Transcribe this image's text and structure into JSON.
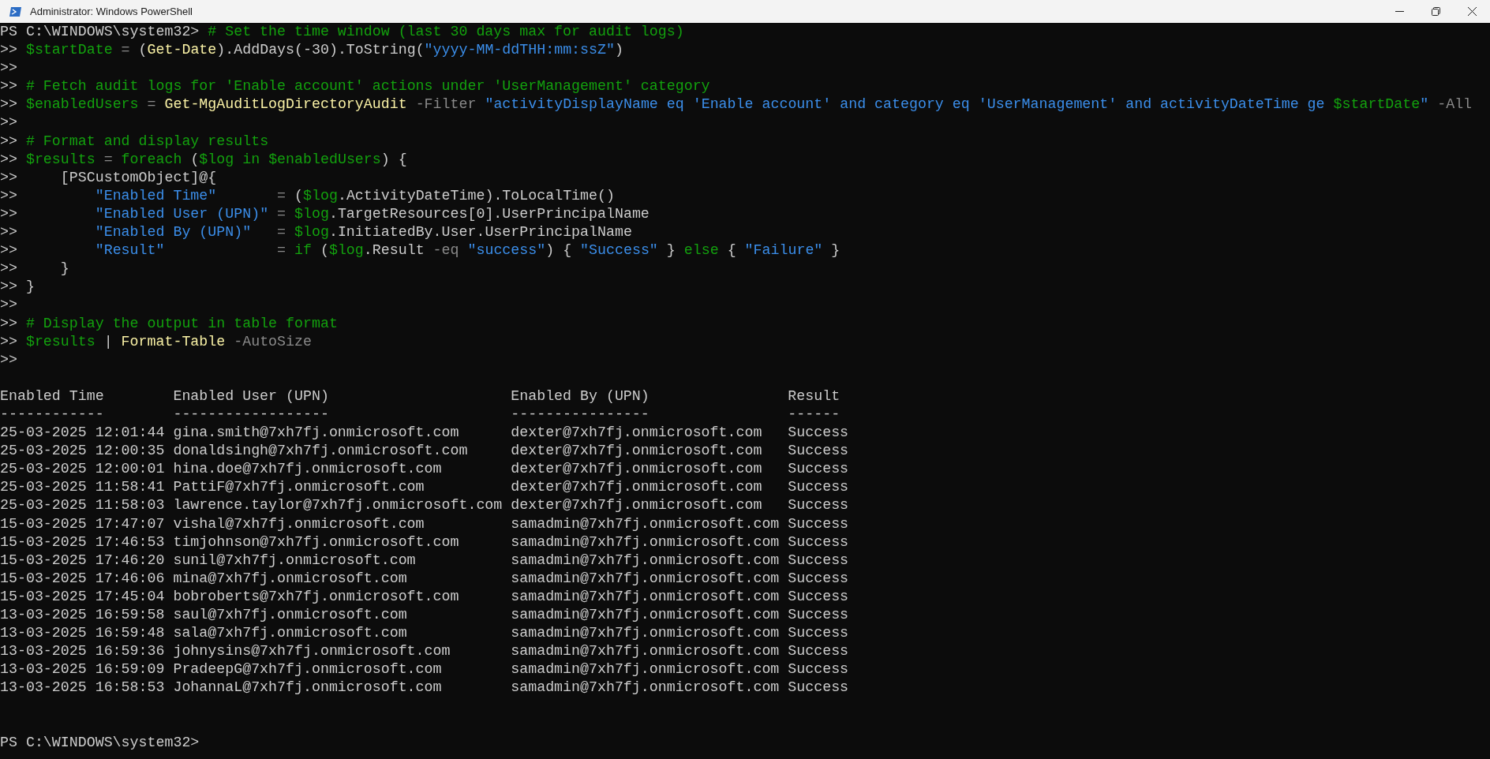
{
  "window": {
    "title": "Administrator: Windows PowerShell"
  },
  "console": {
    "lines": [
      [
        {
          "kind": "prompt",
          "text": "PS C:\\WINDOWS\\system32> "
        },
        {
          "kind": "comment",
          "text": "# Set the time window (last 30 days max for audit logs)"
        }
      ],
      [
        {
          "kind": "prompt",
          "text": ">> "
        },
        {
          "kind": "var",
          "text": "$startDate"
        },
        {
          "kind": "op",
          "text": " = "
        },
        {
          "kind": "plain",
          "text": "("
        },
        {
          "kind": "cmd",
          "text": "Get-Date"
        },
        {
          "kind": "plain",
          "text": ").AddDays(-30).ToString("
        },
        {
          "kind": "str",
          "text": "\"yyyy-MM-ddTHH:mm:ssZ\""
        },
        {
          "kind": "plain",
          "text": ")"
        }
      ],
      [
        {
          "kind": "prompt",
          "text": ">>"
        }
      ],
      [
        {
          "kind": "prompt",
          "text": ">> "
        },
        {
          "kind": "comment",
          "text": "# Fetch audit logs for 'Enable account' actions under 'UserManagement' category"
        }
      ],
      [
        {
          "kind": "prompt",
          "text": ">> "
        },
        {
          "kind": "var",
          "text": "$enabledUsers"
        },
        {
          "kind": "op",
          "text": " = "
        },
        {
          "kind": "cmd",
          "text": "Get-MgAuditLogDirectoryAudit"
        },
        {
          "kind": "op",
          "text": " -Filter "
        },
        {
          "kind": "str",
          "text": "\"activityDisplayName eq 'Enable account' and category eq 'UserManagement' and activityDateTime ge "
        },
        {
          "kind": "var",
          "text": "$startDate"
        },
        {
          "kind": "str",
          "text": "\""
        },
        {
          "kind": "op",
          "text": " -All"
        }
      ],
      [
        {
          "kind": "prompt",
          "text": ">>"
        }
      ],
      [
        {
          "kind": "prompt",
          "text": ">> "
        },
        {
          "kind": "comment",
          "text": "# Format and display results"
        }
      ],
      [
        {
          "kind": "prompt",
          "text": ">> "
        },
        {
          "kind": "var",
          "text": "$results"
        },
        {
          "kind": "op",
          "text": " = "
        },
        {
          "kind": "kw",
          "text": "foreach"
        },
        {
          "kind": "plain",
          "text": " ("
        },
        {
          "kind": "var",
          "text": "$log"
        },
        {
          "kind": "kw",
          "text": " in "
        },
        {
          "kind": "var",
          "text": "$enabledUsers"
        },
        {
          "kind": "plain",
          "text": ") {"
        }
      ],
      [
        {
          "kind": "prompt",
          "text": ">>     "
        },
        {
          "kind": "plain",
          "text": "[PSCustomObject]@{"
        }
      ],
      [
        {
          "kind": "prompt",
          "text": ">>         "
        },
        {
          "kind": "str",
          "text": "\"Enabled Time\""
        },
        {
          "kind": "op",
          "text": "       = "
        },
        {
          "kind": "plain",
          "text": "("
        },
        {
          "kind": "var",
          "text": "$log"
        },
        {
          "kind": "plain",
          "text": ".ActivityDateTime).ToLocalTime()"
        }
      ],
      [
        {
          "kind": "prompt",
          "text": ">>         "
        },
        {
          "kind": "str",
          "text": "\"Enabled User (UPN)\""
        },
        {
          "kind": "op",
          "text": " = "
        },
        {
          "kind": "var",
          "text": "$log"
        },
        {
          "kind": "plain",
          "text": ".TargetResources[0].UserPrincipalName"
        }
      ],
      [
        {
          "kind": "prompt",
          "text": ">>         "
        },
        {
          "kind": "str",
          "text": "\"Enabled By (UPN)\""
        },
        {
          "kind": "op",
          "text": "   = "
        },
        {
          "kind": "var",
          "text": "$log"
        },
        {
          "kind": "plain",
          "text": ".InitiatedBy.User.UserPrincipalName"
        }
      ],
      [
        {
          "kind": "prompt",
          "text": ">>         "
        },
        {
          "kind": "str",
          "text": "\"Result\""
        },
        {
          "kind": "op",
          "text": "             = "
        },
        {
          "kind": "kw",
          "text": "if"
        },
        {
          "kind": "plain",
          "text": " ("
        },
        {
          "kind": "var",
          "text": "$log"
        },
        {
          "kind": "plain",
          "text": ".Result "
        },
        {
          "kind": "op",
          "text": "-eq "
        },
        {
          "kind": "str",
          "text": "\"success\""
        },
        {
          "kind": "plain",
          "text": ") { "
        },
        {
          "kind": "str",
          "text": "\"Success\""
        },
        {
          "kind": "plain",
          "text": " } "
        },
        {
          "kind": "kw",
          "text": "else"
        },
        {
          "kind": "plain",
          "text": " { "
        },
        {
          "kind": "str",
          "text": "\"Failure\""
        },
        {
          "kind": "plain",
          "text": " }"
        }
      ],
      [
        {
          "kind": "prompt",
          "text": ">>     "
        },
        {
          "kind": "plain",
          "text": "}"
        }
      ],
      [
        {
          "kind": "prompt",
          "text": ">> "
        },
        {
          "kind": "plain",
          "text": "}"
        }
      ],
      [
        {
          "kind": "prompt",
          "text": ">>"
        }
      ],
      [
        {
          "kind": "prompt",
          "text": ">> "
        },
        {
          "kind": "comment",
          "text": "# Display the output in table format"
        }
      ],
      [
        {
          "kind": "prompt",
          "text": ">> "
        },
        {
          "kind": "var",
          "text": "$results"
        },
        {
          "kind": "plain",
          "text": " | "
        },
        {
          "kind": "cmd",
          "text": "Format-Table"
        },
        {
          "kind": "op",
          "text": " -AutoSize"
        }
      ],
      [
        {
          "kind": "prompt",
          "text": ">>"
        }
      ]
    ],
    "table": {
      "columns": [
        "Enabled Time",
        "Enabled User (UPN)",
        "Enabled By (UPN)",
        "Result"
      ],
      "underlines": [
        "------------",
        "------------------",
        "----------------",
        "------"
      ],
      "rows": [
        [
          "25-03-2025 12:01:44",
          "gina.smith@7xh7fj.onmicrosoft.com",
          "dexter@7xh7fj.onmicrosoft.com",
          "Success"
        ],
        [
          "25-03-2025 12:00:35",
          "donaldsingh@7xh7fj.onmicrosoft.com",
          "dexter@7xh7fj.onmicrosoft.com",
          "Success"
        ],
        [
          "25-03-2025 12:00:01",
          "hina.doe@7xh7fj.onmicrosoft.com",
          "dexter@7xh7fj.onmicrosoft.com",
          "Success"
        ],
        [
          "25-03-2025 11:58:41",
          "PattiF@7xh7fj.onmicrosoft.com",
          "dexter@7xh7fj.onmicrosoft.com",
          "Success"
        ],
        [
          "25-03-2025 11:58:03",
          "lawrence.taylor@7xh7fj.onmicrosoft.com",
          "dexter@7xh7fj.onmicrosoft.com",
          "Success"
        ],
        [
          "15-03-2025 17:47:07",
          "vishal@7xh7fj.onmicrosoft.com",
          "samadmin@7xh7fj.onmicrosoft.com",
          "Success"
        ],
        [
          "15-03-2025 17:46:53",
          "timjohnson@7xh7fj.onmicrosoft.com",
          "samadmin@7xh7fj.onmicrosoft.com",
          "Success"
        ],
        [
          "15-03-2025 17:46:20",
          "sunil@7xh7fj.onmicrosoft.com",
          "samadmin@7xh7fj.onmicrosoft.com",
          "Success"
        ],
        [
          "15-03-2025 17:46:06",
          "mina@7xh7fj.onmicrosoft.com",
          "samadmin@7xh7fj.onmicrosoft.com",
          "Success"
        ],
        [
          "15-03-2025 17:45:04",
          "bobroberts@7xh7fj.onmicrosoft.com",
          "samadmin@7xh7fj.onmicrosoft.com",
          "Success"
        ],
        [
          "13-03-2025 16:59:58",
          "saul@7xh7fj.onmicrosoft.com",
          "samadmin@7xh7fj.onmicrosoft.com",
          "Success"
        ],
        [
          "13-03-2025 16:59:48",
          "sala@7xh7fj.onmicrosoft.com",
          "samadmin@7xh7fj.onmicrosoft.com",
          "Success"
        ],
        [
          "13-03-2025 16:59:36",
          "johnysins@7xh7fj.onmicrosoft.com",
          "samadmin@7xh7fj.onmicrosoft.com",
          "Success"
        ],
        [
          "13-03-2025 16:59:09",
          "PradeepG@7xh7fj.onmicrosoft.com",
          "samadmin@7xh7fj.onmicrosoft.com",
          "Success"
        ],
        [
          "13-03-2025 16:58:53",
          "JohannaL@7xh7fj.onmicrosoft.com",
          "samadmin@7xh7fj.onmicrosoft.com",
          "Success"
        ]
      ]
    },
    "final_prompt": "PS C:\\WINDOWS\\system32>"
  }
}
